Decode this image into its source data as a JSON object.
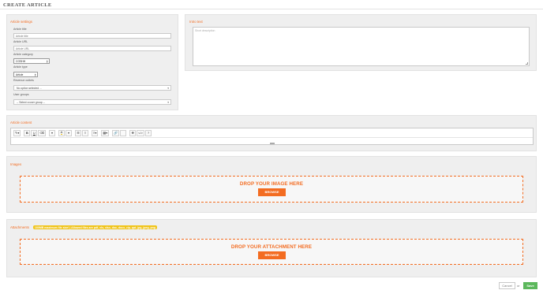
{
  "page": {
    "title": "CREATE ARTICLE"
  },
  "settings": {
    "section_label": "Article settings",
    "title_label": "Article title",
    "title_placeholder": "Article title",
    "url_label": "Article URL",
    "url_placeholder": "Article URL",
    "category_label": "Article category",
    "category_value": "COSHH",
    "type_label": "Article type",
    "type_value": "Article",
    "revenue_label": "Revenue outlets",
    "revenue_value": "No option selected ...",
    "usergroups_label": "User groups",
    "usergroups_value": "-- Select a user group --"
  },
  "intro": {
    "section_label": "Intro text",
    "placeholder": "Short description"
  },
  "content": {
    "section_label": "Article content",
    "toolbar": [
      {
        "name": "magic-wand-icon",
        "glyph": "✎▾"
      },
      {
        "name": "bold-icon",
        "glyph": "B"
      },
      {
        "name": "underline-icon",
        "glyph": "U"
      },
      {
        "name": "eraser-icon",
        "glyph": "⌫"
      },
      {
        "name": "font-size-icon",
        "glyph": "▾"
      },
      {
        "name": "text-color-icon",
        "glyph": "A"
      },
      {
        "name": "color-dropdown-icon",
        "glyph": "▾"
      },
      {
        "name": "unordered-list-icon",
        "glyph": "☰"
      },
      {
        "name": "ordered-list-icon",
        "glyph": "≡"
      },
      {
        "name": "align-icon",
        "glyph": "≡▾"
      },
      {
        "name": "table-icon",
        "glyph": "▦▾"
      },
      {
        "name": "link-icon",
        "glyph": "🔗"
      },
      {
        "name": "blank-icon",
        "glyph": ""
      },
      {
        "name": "fullscreen-icon",
        "glyph": "✥"
      },
      {
        "name": "code-view-icon",
        "glyph": "</>"
      },
      {
        "name": "help-icon",
        "glyph": "?"
      }
    ]
  },
  "images": {
    "section_label": "Images",
    "drop_title": "DROP YOUR IMAGE HERE",
    "browse_label": "BROWSE"
  },
  "attachments": {
    "section_label": "Attachments",
    "hint": "100MB maximum file size! | Allowed files are pdf, xls, xlsx, doc, docx, zip, ppt, jpg, jpeg, png",
    "drop_title": "DROP YOUR ATTACHMENT HERE",
    "browse_label": "BROWSE"
  },
  "footer": {
    "cancel_label": "Cancel",
    "or_label": "or",
    "save_label": "Save"
  },
  "colors": {
    "accent": "#f36c21",
    "save": "#5cb85c",
    "badge": "#f0c419"
  }
}
